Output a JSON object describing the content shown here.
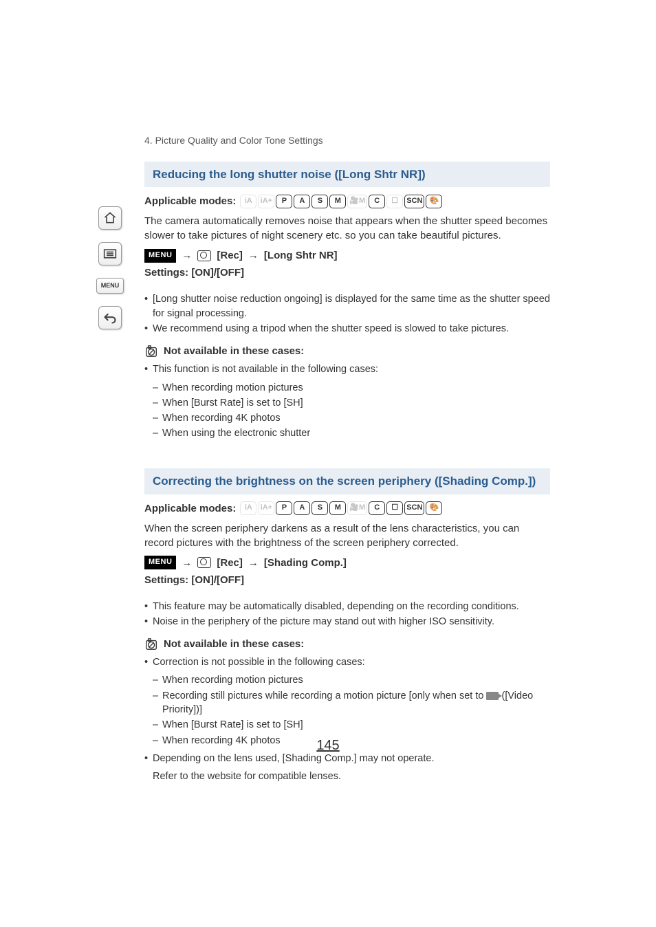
{
  "sidebar": {
    "menu_label": "MENU"
  },
  "chapter": "4. Picture Quality and Color Tone Settings",
  "section1": {
    "title": "Reducing the long shutter noise ([Long Shtr NR])",
    "applicable_label": "Applicable modes:",
    "modes": [
      {
        "label": "iA",
        "dim": true
      },
      {
        "label": "iA+",
        "dim": true
      },
      {
        "label": "P",
        "dim": false
      },
      {
        "label": "A",
        "dim": false
      },
      {
        "label": "S",
        "dim": false
      },
      {
        "label": "M",
        "dim": false
      },
      {
        "label": "🎥M",
        "dim": true
      },
      {
        "label": "C",
        "dim": false
      },
      {
        "label": "☐",
        "dim": true
      },
      {
        "label": "SCN",
        "dim": false
      },
      {
        "label": "🎨",
        "dim": false
      }
    ],
    "body": "The camera automatically removes noise that appears when the shutter speed becomes slower to take pictures of night scenery etc. so you can take beautiful pictures.",
    "menu_badge": "MENU",
    "menu_rec": "[Rec]",
    "menu_item": "[Long Shtr NR]",
    "settings": "Settings: [ON]/[OFF]",
    "notes": [
      "[Long shutter noise reduction ongoing] is displayed for the same time as the shutter speed for signal processing.",
      "We recommend using a tripod when the shutter speed is slowed to take pictures."
    ],
    "na_title": "Not available in these cases:",
    "na_lead": "This function is not available in the following cases:",
    "na_items": [
      "When recording motion pictures",
      "When [Burst Rate] is set to [SH]",
      "When recording 4K photos",
      "When using the electronic shutter"
    ]
  },
  "section2": {
    "title": "Correcting the brightness on the screen periphery ([Shading Comp.])",
    "applicable_label": "Applicable modes:",
    "modes": [
      {
        "label": "iA",
        "dim": true
      },
      {
        "label": "iA+",
        "dim": true
      },
      {
        "label": "P",
        "dim": false
      },
      {
        "label": "A",
        "dim": false
      },
      {
        "label": "S",
        "dim": false
      },
      {
        "label": "M",
        "dim": false
      },
      {
        "label": "🎥M",
        "dim": true
      },
      {
        "label": "C",
        "dim": false
      },
      {
        "label": "☐",
        "dim": false
      },
      {
        "label": "SCN",
        "dim": false
      },
      {
        "label": "🎨",
        "dim": false
      }
    ],
    "body": "When the screen periphery darkens as a result of the lens characteristics, you can record pictures with the brightness of the screen periphery corrected.",
    "menu_badge": "MENU",
    "menu_rec": "[Rec]",
    "menu_item": "[Shading Comp.]",
    "settings": "Settings: [ON]/[OFF]",
    "notes": [
      "This feature may be automatically disabled, depending on the recording conditions.",
      "Noise in the periphery of the picture may stand out with higher ISO sensitivity."
    ],
    "na_title": "Not available in these cases:",
    "na_lead": "Correction is not possible in the following cases:",
    "na_items": [
      "When recording motion pictures",
      "Recording still pictures while recording a motion picture [only when set to [ICON] ([Video Priority])]",
      "When [Burst Rate] is set to [SH]",
      "When recording 4K photos"
    ],
    "na_trailing": [
      "Depending on the lens used, [Shading Comp.] may not operate."
    ],
    "na_trailing_extra": "Refer to the website for compatible lenses."
  },
  "page_number": "145"
}
